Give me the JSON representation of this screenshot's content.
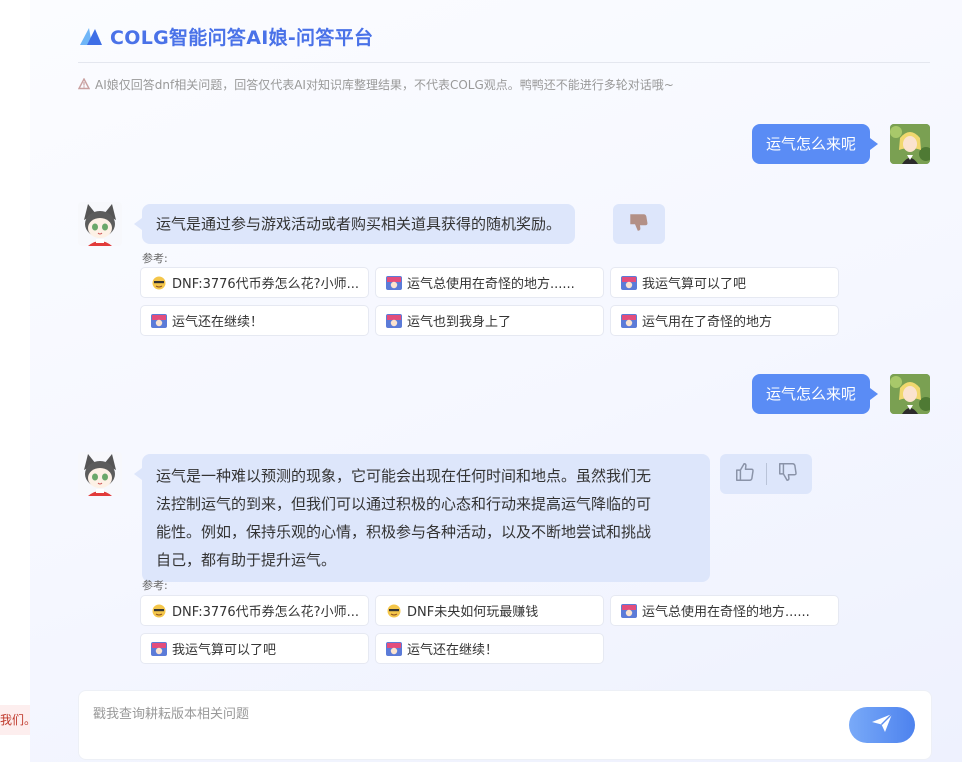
{
  "header": {
    "title": "COLG智能问答AI娘-问答平台",
    "notice": "AI娘仅回答dnf相关问题，回答仅代表AI对知识库整理结果，不代表COLG观点。鸭鸭还不能进行多轮对话哦~"
  },
  "side_toast": "我们。",
  "conversation": [
    {
      "question": "运气怎么来呢",
      "answer": "运气是通过参与游戏活动或者购买相关道具获得的随机奖励。",
      "ref_label": "参考:",
      "refs": [
        {
          "label": "DNF:3776代币券怎么花?小师...",
          "icon": "emoji-icon"
        },
        {
          "label": "运气总使用在奇怪的地方......",
          "icon": "colg-icon"
        },
        {
          "label": "我运气算可以了吧",
          "icon": "colg-icon"
        },
        {
          "label": "运气还在继续！",
          "icon": "colg-icon"
        },
        {
          "label": "运气也到我身上了",
          "icon": "colg-icon"
        },
        {
          "label": "运气用在了奇怪的地方",
          "icon": "colg-icon"
        }
      ]
    },
    {
      "question": "运气怎么来呢",
      "answer_lines": [
        "运气是一种难以预测的现象，它可能会出现在任何时间和地点。虽然我们无",
        "法控制运气的到来，但我们可以通过积极的心态和行动来提高运气降临的可",
        "能性。例如，保持乐观的心情，积极参与各种活动，以及不断地尝试和挑战",
        "自己，都有助于提升运气。"
      ],
      "ref_label": "参考:",
      "refs": [
        {
          "label": "DNF:3776代币券怎么花?小师...",
          "icon": "emoji-icon"
        },
        {
          "label": "DNF未央如何玩最赚钱",
          "icon": "emoji-icon"
        },
        {
          "label": "运气总使用在奇怪的地方......",
          "icon": "colg-icon"
        },
        {
          "label": "我运气算可以了吧",
          "icon": "colg-icon"
        },
        {
          "label": "运气还在继续！",
          "icon": "colg-icon"
        }
      ]
    }
  ],
  "input": {
    "placeholder": "戳我查询耕耘版本相关问题",
    "value": ""
  },
  "colors": {
    "accent": "#4a72e8",
    "user_bubble": "#5a8cf5",
    "bot_bubble": "#dde6fb"
  }
}
